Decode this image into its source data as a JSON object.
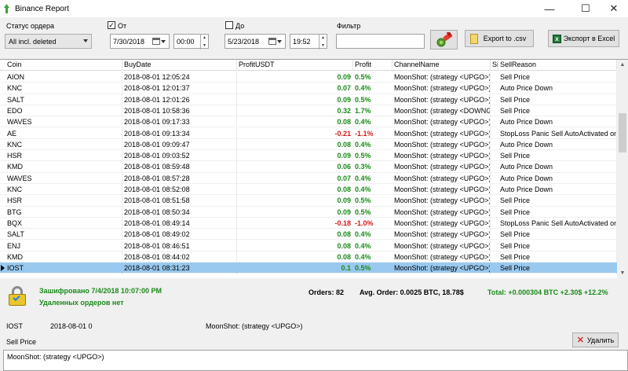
{
  "window": {
    "title": "Binance Report",
    "minimize": "—",
    "maximize": "☐",
    "close": "✕"
  },
  "filters": {
    "status_label": "Статус ордера",
    "status_value": "All incl. deleted",
    "from_label": "От",
    "from_checked": true,
    "from_date": "7/30/2018",
    "from_time": "00:00",
    "to_label": "До",
    "to_checked": false,
    "to_date": "5/23/2018",
    "to_time": "19:52",
    "filter_label": "Фильтр",
    "filter_value": "",
    "export_csv": "Export to .csv",
    "export_excel": "Экспорт в Excel"
  },
  "table": {
    "columns": [
      "Coin",
      "BuyDate",
      "ProfitUSDT",
      "Profit",
      "ChannelName",
      "Si",
      "SellReason"
    ],
    "rows": [
      {
        "coin": "AION",
        "date": "2018-08-01 12:05:24",
        "usdt": "0.09",
        "pct": "0.5%",
        "channel": "MoonShot: (strategy <UPGO>)",
        "reason": "Sell Price",
        "neg": false
      },
      {
        "coin": "KNC",
        "date": "2018-08-01 12:01:37",
        "usdt": "0.07",
        "pct": "0.4%",
        "channel": "MoonShot: (strategy <UPGO>)",
        "reason": "Auto Price Down",
        "neg": false
      },
      {
        "coin": "SALT",
        "date": "2018-08-01 12:01:26",
        "usdt": "0.09",
        "pct": "0.5%",
        "channel": "MoonShot: (strategy <UPGO>)",
        "reason": "Sell Price",
        "neg": false
      },
      {
        "coin": "EDO",
        "date": "2018-08-01 10:58:36",
        "usdt": "0.32",
        "pct": "1.7%",
        "channel": "MoonShot: (strategy <DOWNGO",
        "reason": "Sell Price",
        "neg": false
      },
      {
        "coin": "WAVES",
        "date": "2018-08-01 09:17:33",
        "usdt": "0.08",
        "pct": "0.4%",
        "channel": "MoonShot: (strategy <UPGO>)",
        "reason": "Auto Price Down",
        "neg": false
      },
      {
        "coin": "AE",
        "date": "2018-08-01 09:13:34",
        "usdt": "-0.21",
        "pct": "-1.1%",
        "channel": "MoonShot: (strategy <UPGO>)",
        "reason": "StopLoss Panic Sell AutoActivated on s",
        "neg": true
      },
      {
        "coin": "KNC",
        "date": "2018-08-01 09:09:47",
        "usdt": "0.08",
        "pct": "0.4%",
        "channel": "MoonShot: (strategy <UPGO>)",
        "reason": "Auto Price Down",
        "neg": false
      },
      {
        "coin": "HSR",
        "date": "2018-08-01 09:03:52",
        "usdt": "0.09",
        "pct": "0.5%",
        "channel": "MoonShot: (strategy <UPGO>)",
        "reason": "Sell Price",
        "neg": false
      },
      {
        "coin": "KMD",
        "date": "2018-08-01 08:59:48",
        "usdt": "0.06",
        "pct": "0.3%",
        "channel": "MoonShot: (strategy <UPGO>)",
        "reason": "Auto Price Down",
        "neg": false
      },
      {
        "coin": "WAVES",
        "date": "2018-08-01 08:57:28",
        "usdt": "0.07",
        "pct": "0.4%",
        "channel": "MoonShot: (strategy <UPGO>)",
        "reason": "Auto Price Down",
        "neg": false
      },
      {
        "coin": "KNC",
        "date": "2018-08-01 08:52:08",
        "usdt": "0.08",
        "pct": "0.4%",
        "channel": "MoonShot: (strategy <UPGO>)",
        "reason": "Auto Price Down",
        "neg": false
      },
      {
        "coin": "HSR",
        "date": "2018-08-01 08:51:58",
        "usdt": "0.09",
        "pct": "0.5%",
        "channel": "MoonShot: (strategy <UPGO>)",
        "reason": "Sell Price",
        "neg": false
      },
      {
        "coin": "BTG",
        "date": "2018-08-01 08:50:34",
        "usdt": "0.09",
        "pct": "0.5%",
        "channel": "MoonShot: (strategy <UPGO>)",
        "reason": "Sell Price",
        "neg": false
      },
      {
        "coin": "BQX",
        "date": "2018-08-01 08:49:14",
        "usdt": "-0.18",
        "pct": "-1.0%",
        "channel": "MoonShot: (strategy <UPGO>)",
        "reason": "StopLoss Panic Sell AutoActivated on s",
        "neg": true
      },
      {
        "coin": "SALT",
        "date": "2018-08-01 08:49:02",
        "usdt": "0.08",
        "pct": "0.4%",
        "channel": "MoonShot: (strategy <UPGO>)",
        "reason": "Sell Price",
        "neg": false
      },
      {
        "coin": "ENJ",
        "date": "2018-08-01 08:46:51",
        "usdt": "0.08",
        "pct": "0.4%",
        "channel": "MoonShot: (strategy <UPGO>)",
        "reason": "Sell Price",
        "neg": false
      },
      {
        "coin": "KMD",
        "date": "2018-08-01 08:44:02",
        "usdt": "0.08",
        "pct": "0.4%",
        "channel": "MoonShot: (strategy <UPGO>)",
        "reason": "Sell Price",
        "neg": false
      },
      {
        "coin": "IOST",
        "date": "2018-08-01 08:31:23",
        "usdt": "0.1",
        "pct": "0.5%",
        "channel": "MoonShot: (strategy <UPGO>)",
        "reason": "Sell Price",
        "neg": false,
        "selected": true
      }
    ]
  },
  "summary": {
    "encrypted": "Зашифровано 7/4/2018 10:07:00 PM",
    "deleted": "Удаленных ордеров нет",
    "orders": "Orders: 82",
    "avg_order": "Avg. Order:  0.0025 BTC,  18.78$",
    "total": "Total: +0.000304 BTC  +2.30$  +12.2%"
  },
  "detail": {
    "coin": "IOST",
    "date": "2018-08-01 0",
    "channel": "MoonShot: (strategy <UPGO>)",
    "reason": "Sell Price",
    "delete_button": "Удалить",
    "memo": "MoonShot: (strategy <UPGO>)"
  }
}
